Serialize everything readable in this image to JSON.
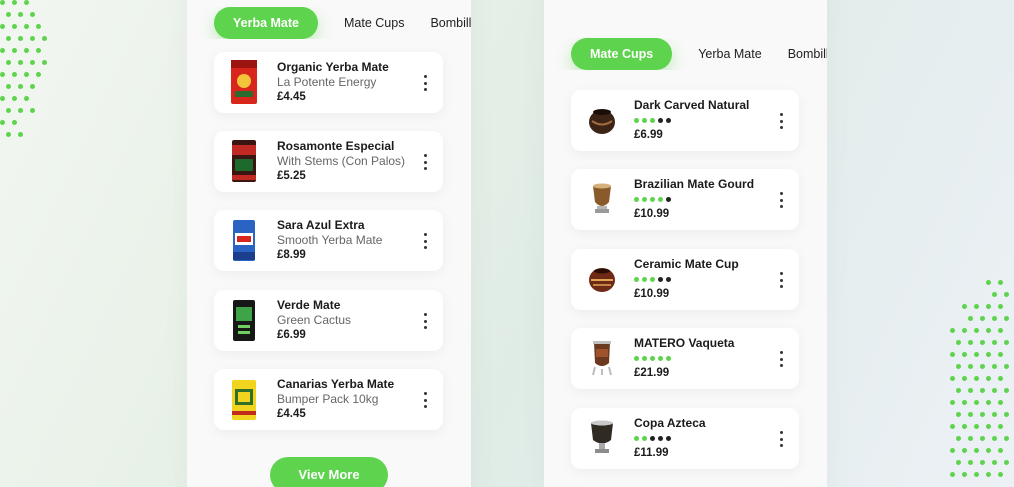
{
  "colors": {
    "accent": "#5ed34d",
    "star_empty": "#222222",
    "background": "#e8f1e8"
  },
  "left_panel": {
    "tabs": [
      {
        "label": "Yerba Mate",
        "active": true
      },
      {
        "label": "Mate Cups",
        "active": false
      },
      {
        "label": "Bombilla",
        "active": false
      }
    ],
    "products": [
      {
        "name": "Organic Yerba Mate",
        "subtitle": "La Potente Energy",
        "price": "£4.45",
        "image": "red-yerba-pack-icon"
      },
      {
        "name": "Rosamonte Especial",
        "subtitle": "With Stems (Con Palos)",
        "price": "£5.25",
        "image": "dark-red-yerba-pack-icon"
      },
      {
        "name": "Sara Azul Extra",
        "subtitle": "Smooth Yerba Mate",
        "price": "£8.99",
        "image": "blue-yerba-pack-icon"
      },
      {
        "name": "Verde Mate",
        "subtitle": "Green Cactus",
        "price": "£6.99",
        "image": "black-green-yerba-pack-icon"
      },
      {
        "name": "Canarias Yerba Mate",
        "subtitle": "Bumper Pack 10kg",
        "price": "£4.45",
        "image": "yellow-yerba-pack-icon"
      }
    ],
    "view_more_label": "Viev More"
  },
  "right_panel": {
    "tabs": [
      {
        "label": "Mate Cups",
        "active": true
      },
      {
        "label": "Yerba Mate",
        "active": false
      },
      {
        "label": "Bombilla",
        "active": false
      }
    ],
    "products": [
      {
        "name": "Dark Carved Natural",
        "rating": 3,
        "price": "£6.99",
        "image": "dark-gourd-icon"
      },
      {
        "name": "Brazilian Mate Gourd",
        "rating": 4,
        "price": "£10.99",
        "image": "brazilian-gourd-icon"
      },
      {
        "name": "Ceramic Mate Cup",
        "rating": 3,
        "price": "£10.99",
        "image": "ceramic-cup-icon"
      },
      {
        "name": "MATERO Vaqueta",
        "rating": 5,
        "price": "£21.99",
        "image": "leather-matero-icon"
      },
      {
        "name": "Copa Azteca",
        "rating": 2,
        "price": "£11.99",
        "image": "azteca-cup-icon"
      }
    ]
  }
}
